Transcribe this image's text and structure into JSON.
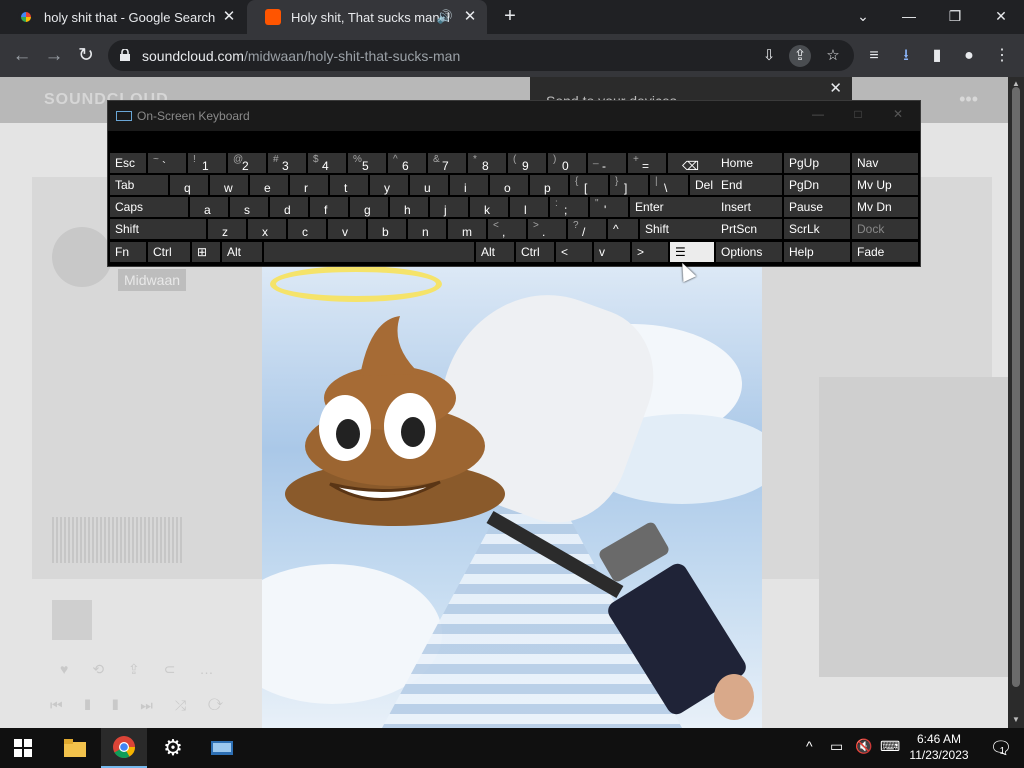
{
  "browser": {
    "tabs": [
      {
        "title": "holy shit that - Google Search",
        "icon": "google-icon",
        "active": false
      },
      {
        "title": "Holy shit, That sucks man. b",
        "icon": "soundcloud-icon",
        "active": true
      }
    ],
    "url_domain": "soundcloud.com",
    "url_path": "/midwaan/holy-shit-that-sucks-man"
  },
  "page": {
    "logo": "SOUNDCLOUD",
    "send_devices": "Send to your devices",
    "artist": "Midwaan"
  },
  "osk": {
    "title": "On-Screen Keyboard",
    "rows": [
      [
        [
          "Esc",
          ""
        ],
        [
          "~",
          "`"
        ],
        [
          "!",
          "1"
        ],
        [
          "@",
          "2"
        ],
        [
          "#",
          "3"
        ],
        [
          "$",
          "4"
        ],
        [
          "%",
          "5"
        ],
        [
          "^",
          "6"
        ],
        [
          "&",
          "7"
        ],
        [
          "*",
          "8"
        ],
        [
          "(",
          "9"
        ],
        [
          ")",
          "0"
        ],
        [
          "_",
          "-"
        ],
        [
          "+",
          "="
        ],
        [
          "",
          "⌫"
        ]
      ],
      [
        [
          "Tab",
          ""
        ],
        [
          "",
          "q"
        ],
        [
          "",
          "w"
        ],
        [
          "",
          "e"
        ],
        [
          "",
          "r"
        ],
        [
          "",
          "t"
        ],
        [
          "",
          "y"
        ],
        [
          "",
          "u"
        ],
        [
          "",
          "i"
        ],
        [
          "",
          "o"
        ],
        [
          "",
          "p"
        ],
        [
          "{",
          "["
        ],
        [
          "}",
          "]"
        ],
        [
          "|",
          "\\"
        ],
        [
          "Del",
          ""
        ]
      ],
      [
        [
          "Caps",
          ""
        ],
        [
          "",
          "a"
        ],
        [
          "",
          "s"
        ],
        [
          "",
          "d"
        ],
        [
          "",
          "f"
        ],
        [
          "",
          "g"
        ],
        [
          "",
          "h"
        ],
        [
          "",
          "j"
        ],
        [
          "",
          "k"
        ],
        [
          "",
          "l"
        ],
        [
          ":",
          ";"
        ],
        [
          "\"",
          "'"
        ],
        [
          "Enter",
          ""
        ]
      ],
      [
        [
          "Shift",
          ""
        ],
        [
          "",
          "z"
        ],
        [
          "",
          "x"
        ],
        [
          "",
          "c"
        ],
        [
          "",
          "v"
        ],
        [
          "",
          "b"
        ],
        [
          "",
          "n"
        ],
        [
          "",
          "m"
        ],
        [
          "<",
          ","
        ],
        [
          ">",
          "."
        ],
        [
          "?",
          "/"
        ],
        [
          "^",
          ""
        ],
        [
          "Shift",
          ""
        ]
      ],
      [
        [
          "Fn",
          ""
        ],
        [
          "Ctrl",
          ""
        ],
        [
          "⊞",
          ""
        ],
        [
          "Alt",
          ""
        ],
        [
          "",
          ""
        ],
        [
          "Alt",
          ""
        ],
        [
          "Ctrl",
          ""
        ],
        [
          "<",
          ""
        ],
        [
          "v",
          ""
        ],
        [
          ">",
          ""
        ],
        [
          "☰",
          ""
        ]
      ]
    ],
    "nav_keys": [
      [
        "Home",
        "PgUp",
        "Nav"
      ],
      [
        "End",
        "PgDn",
        "Mv Up"
      ],
      [
        "Insert",
        "Pause",
        "Mv Dn"
      ],
      [
        "PrtScn",
        "ScrLk",
        "Dock"
      ],
      [
        "Options",
        "Help",
        "Fade"
      ]
    ]
  },
  "taskbar": {
    "time": "6:46 AM",
    "date": "11/23/2023",
    "notifications": "1"
  }
}
